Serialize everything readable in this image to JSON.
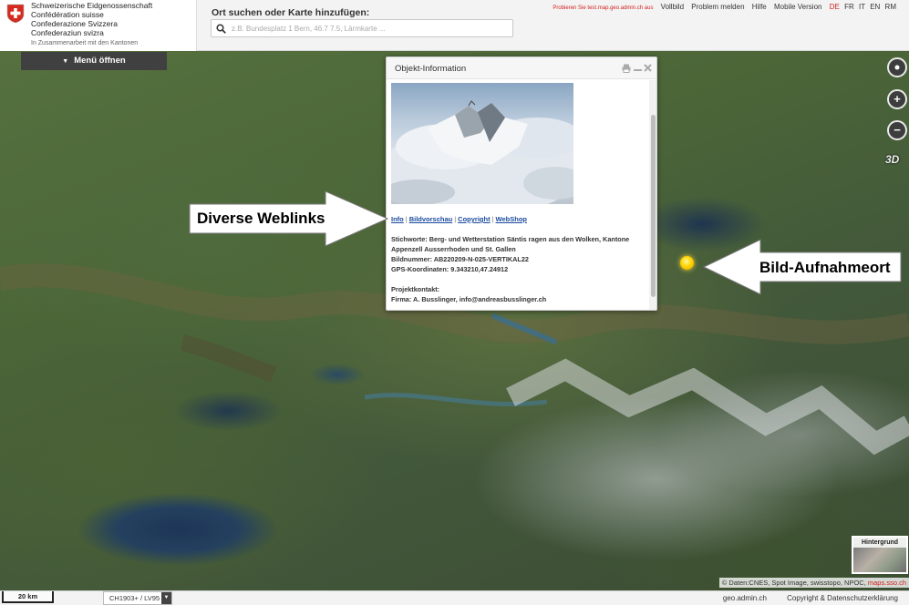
{
  "header": {
    "brand_lines": [
      "Schweizerische Eidgenossenschaft",
      "Confédération suisse",
      "Confederazione Svizzera",
      "Confederaziun svizra"
    ],
    "cooperation": "In Zusammenarbeit mit den Kantonen",
    "search_label": "Ort suchen oder Karte hinzufügen:",
    "search_placeholder": "z.B. Bundesplatz 1 Bern, 46.7 7.5, Lärmkarte ...",
    "nav": {
      "test_link": "Probieren Sie test.map.geo.admin.ch aus",
      "fullscreen": "Vollbild",
      "report_problem": "Problem melden",
      "help": "Hilfe",
      "mobile": "Mobile Version"
    },
    "languages": [
      "DE",
      "FR",
      "IT",
      "EN",
      "RM"
    ],
    "active_language": "DE"
  },
  "menu": {
    "label": "Menü öffnen"
  },
  "map_controls": {
    "three_d": "3D"
  },
  "popup": {
    "title": "Objekt-Information",
    "links": [
      "Info",
      "Bildvorschau",
      "Copyright",
      "WebShop"
    ],
    "details": {
      "keywords": "Stichworte: Berg- und Wetterstation Säntis ragen aus den Wolken, Kantone",
      "keywords_cont": "Appenzell Ausserrhoden und St. Gallen",
      "image_number": "Bildnummer: AB220209-N-025-VERTIKAL22",
      "gps": "GPS-Koordinaten: 9.343210,47.24912",
      "contact_label": "Projektkontakt:",
      "contact": "Firma: A. Busslinger, info@andreasbusslinger.ch"
    }
  },
  "annotations": {
    "weblinks": "Diverse Weblinks",
    "photo_location": "Bild-Aufnahmeort"
  },
  "background_selector": {
    "label": "Hintergrund"
  },
  "attribution": {
    "text": "© Daten:CNES, Spot Image, swisstopo, NPOC,",
    "link": "maps.sso.ch"
  },
  "footer": {
    "scale": "20 km",
    "crs": "CH1903+ / LV95",
    "site": "geo.admin.ch",
    "copyright": "Copyright & Datenschutzerklärung"
  },
  "colors": {
    "accent_red": "#d21f1f",
    "link_blue": "#1a4a9e",
    "marker_yellow": "#ffd400"
  }
}
